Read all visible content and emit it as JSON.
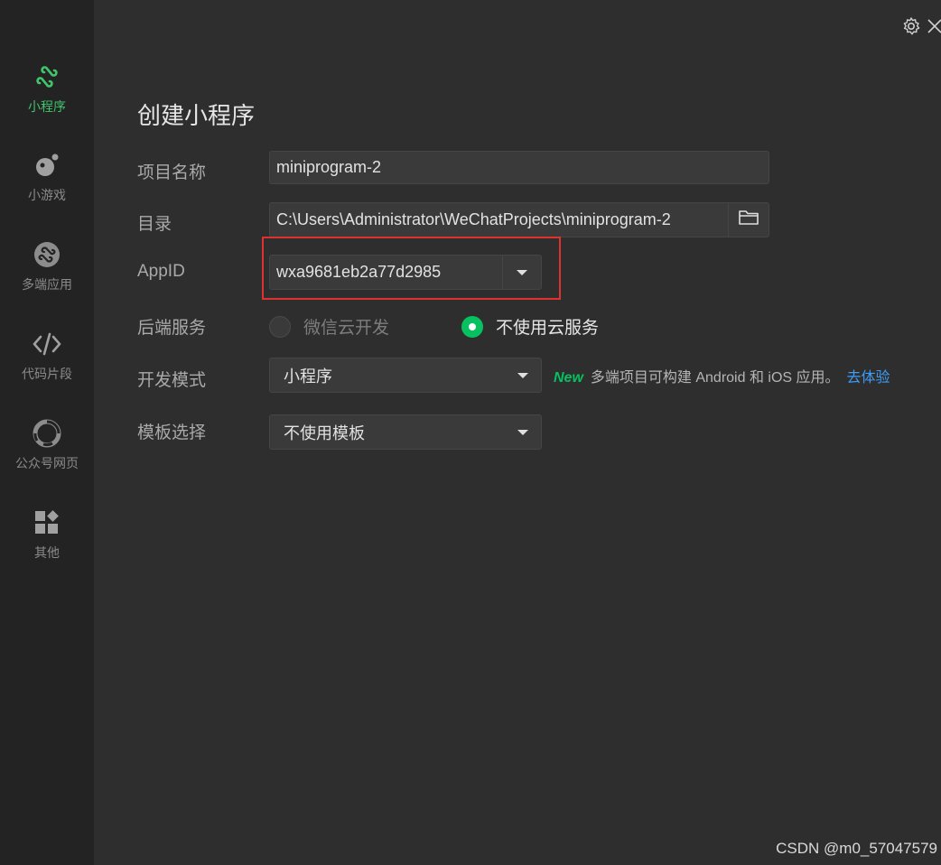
{
  "sidebar": {
    "items": [
      {
        "label": "小程序",
        "icon": "miniprogram-icon",
        "active": true
      },
      {
        "label": "小游戏",
        "icon": "minigame-icon",
        "active": false
      },
      {
        "label": "多端应用",
        "icon": "multiplatform-icon",
        "active": false
      },
      {
        "label": "代码片段",
        "icon": "code-snippet-icon",
        "active": false
      },
      {
        "label": "公众号网页",
        "icon": "official-account-icon",
        "active": false
      },
      {
        "label": "其他",
        "icon": "other-apps-icon",
        "active": false
      }
    ]
  },
  "header": {
    "title": "创建小程序"
  },
  "form": {
    "project_name": {
      "label": "项目名称",
      "value": "miniprogram-2"
    },
    "directory": {
      "label": "目录",
      "value": "C:\\Users\\Administrator\\WeChatProjects\\miniprogram-2"
    },
    "appid": {
      "label": "AppID",
      "value": "wxa9681eb2a77d2985"
    },
    "backend": {
      "label": "后端服务",
      "options": [
        {
          "label": "微信云开发",
          "selected": false
        },
        {
          "label": "不使用云服务",
          "selected": true
        }
      ]
    },
    "dev_mode": {
      "label": "开发模式",
      "value": "小程序",
      "hint_new": "New",
      "hint_text": "多端项目可构建 Android 和 iOS 应用。",
      "hint_link": "去体验"
    },
    "template": {
      "label": "模板选择",
      "value": "不使用模板"
    }
  },
  "watermark": "CSDN @m0_57047579",
  "colors": {
    "accent": "#07c160",
    "link": "#3f9cf5",
    "highlight": "#e03131"
  }
}
